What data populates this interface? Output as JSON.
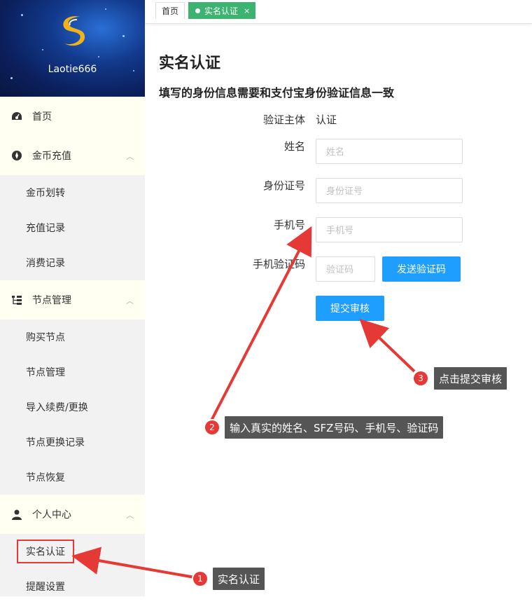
{
  "sidebar": {
    "username": "Laotie666",
    "menu": [
      {
        "type": "parent",
        "label": "首页",
        "icon": "dashboard-icon",
        "has_chevron": false
      },
      {
        "type": "parent",
        "label": "金币充值",
        "icon": "coin-icon",
        "has_chevron": true
      },
      {
        "type": "child",
        "label": "金币划转"
      },
      {
        "type": "child",
        "label": "充值记录"
      },
      {
        "type": "child",
        "label": "消费记录"
      },
      {
        "type": "parent",
        "label": "节点管理",
        "icon": "tree-icon",
        "has_chevron": true
      },
      {
        "type": "child",
        "label": "购买节点"
      },
      {
        "type": "child",
        "label": "节点管理"
      },
      {
        "type": "child",
        "label": "导入续费/更换"
      },
      {
        "type": "child",
        "label": "节点更换记录"
      },
      {
        "type": "child",
        "label": "节点恢复"
      },
      {
        "type": "parent",
        "label": "个人中心",
        "icon": "user-icon",
        "has_chevron": true
      },
      {
        "type": "child",
        "label": "实名认证",
        "active": true
      },
      {
        "type": "child",
        "label": "提醒设置"
      }
    ]
  },
  "tabs": {
    "home": "首页",
    "active": "实名认证",
    "close": "×"
  },
  "main": {
    "title": "实名认证",
    "notice": "填写的身份信息需要和支付宝身份验证信息一致",
    "form": {
      "subject_label": "验证主体",
      "subject_value": "认证",
      "name_label": "姓名",
      "name_placeholder": "姓名",
      "id_label": "身份证号",
      "id_placeholder": "身份证号",
      "phone_label": "手机号",
      "phone_placeholder": "手机号",
      "code_label": "手机验证码",
      "code_placeholder": "验证码",
      "send_code_button": "发送验证码",
      "submit_button": "提交审核"
    }
  },
  "annotations": {
    "step1": {
      "num": "1",
      "text": "实名认证"
    },
    "step2": {
      "num": "2",
      "text": "输入真实的姓名、SFZ号码、手机号、验证码"
    },
    "step3": {
      "num": "3",
      "text": "点击提交审核"
    }
  },
  "colors": {
    "primary": "#1e9fff",
    "tab_active": "#3cb371",
    "annotation_red": "#e53935",
    "callout_bg": "#555555"
  }
}
